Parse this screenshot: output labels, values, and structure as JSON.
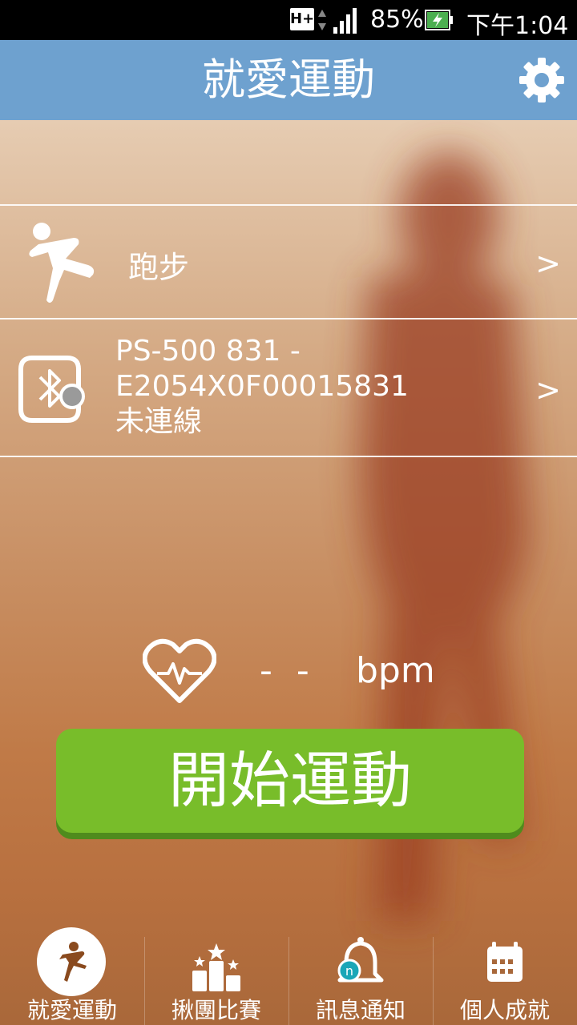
{
  "status_bar": {
    "network": "H+",
    "battery_percent": "85%",
    "time": "下午1:04"
  },
  "header": {
    "title": "就愛運動"
  },
  "sport": {
    "label": "跑步",
    "chevron": ">"
  },
  "device": {
    "line1": "PS-500 831 -",
    "line2": "E2054X0F00015831",
    "status": "未連線",
    "chevron": ">"
  },
  "heart_rate": {
    "value": "- -",
    "unit": "bpm"
  },
  "start_button": {
    "label": "開始運動"
  },
  "bottom_nav": {
    "items": [
      {
        "label": "就愛運動"
      },
      {
        "label": "揪團比賽"
      },
      {
        "label": "訊息通知"
      },
      {
        "label": "個人成就"
      }
    ]
  },
  "colors": {
    "header": "#6ea1cf",
    "start_button": "#78bd2a"
  }
}
